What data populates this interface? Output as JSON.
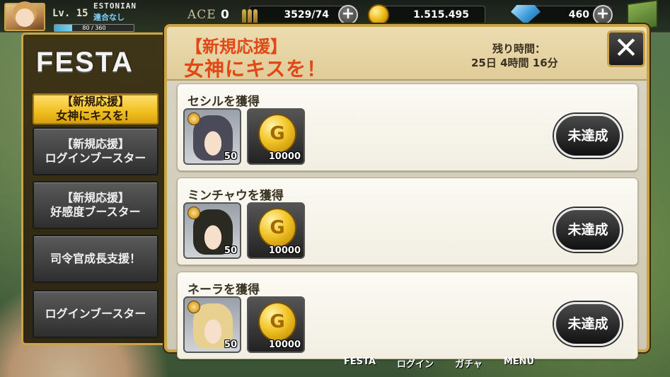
{
  "hud": {
    "level": "Lv. 15",
    "player_name": "ESTONIAN",
    "guild": "連合なし",
    "exp_text": "80 / 360",
    "exp_fraction": 0.22,
    "ace_label": "ACE",
    "ace_value": "0",
    "ammo": "3529/74",
    "gold": "1.515.495",
    "gems": "460",
    "plus_symbol": "+"
  },
  "sidebar": {
    "title": "FESTA",
    "tabs": [
      {
        "label": "【新規応援】\n女神にキスを！",
        "active": true
      },
      {
        "label": "【新規応援】\nログインブースター",
        "active": false
      },
      {
        "label": "【新規応援】\n好感度ブースター",
        "active": false
      },
      {
        "label": "司令官成長支援！",
        "active": false
      },
      {
        "label": "ログインブースター",
        "active": false
      }
    ]
  },
  "event": {
    "title_line1": "【新規応援】",
    "title_line2": "女神にキスを！",
    "remaining_label": "残り時間：",
    "remaining_value": "25日 4時間 16分",
    "close_symbol": "✕"
  },
  "missions": [
    {
      "title": "セシルを獲得",
      "char_level": "50",
      "coin_amount": "10000",
      "status": "未達成",
      "hair_color": "#4a4a58"
    },
    {
      "title": "ミンチャウを獲得",
      "char_level": "50",
      "coin_amount": "10000",
      "status": "未達成",
      "hair_color": "#2a2a22"
    },
    {
      "title": "ネーラを獲得",
      "char_level": "50",
      "coin_amount": "10000",
      "status": "未達成",
      "hair_color": "#e8d090"
    }
  ],
  "bottom_nav": [
    "FESTA",
    "ログイン",
    "ガチャ",
    "MENU"
  ],
  "colors": {
    "accent_gold": "#c9a448",
    "title_red": "#e04818",
    "active_tab": "#f0c020"
  }
}
